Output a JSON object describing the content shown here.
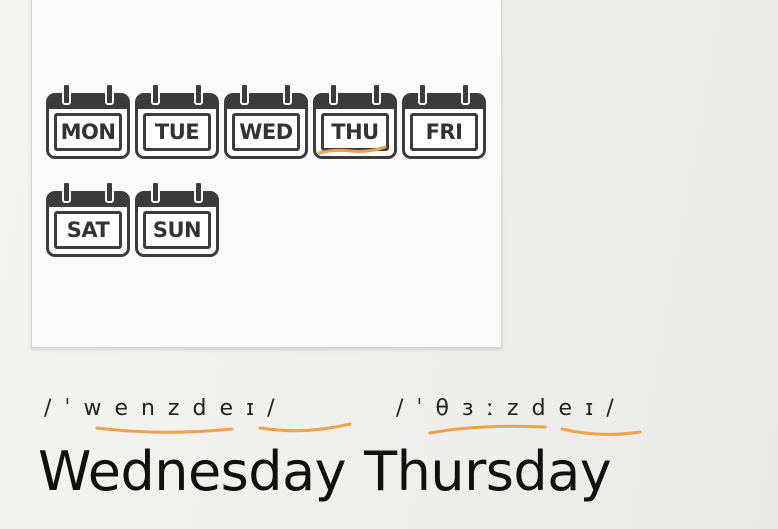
{
  "days": {
    "mon": "MON",
    "tue": "TUE",
    "wed": "WED",
    "thu": "THU",
    "fri": "FRI",
    "sat": "SAT",
    "sun": "SUN"
  },
  "ipa": {
    "wednesday": "/ˈwenzdeɪ/",
    "thursday": "/ˈθɜːzdeɪ/"
  },
  "words": {
    "wednesday": "Wednesday",
    "thursday": "Thursday"
  },
  "colors": {
    "highlight": "#f0a24a",
    "icon": "#3c3c3c"
  }
}
